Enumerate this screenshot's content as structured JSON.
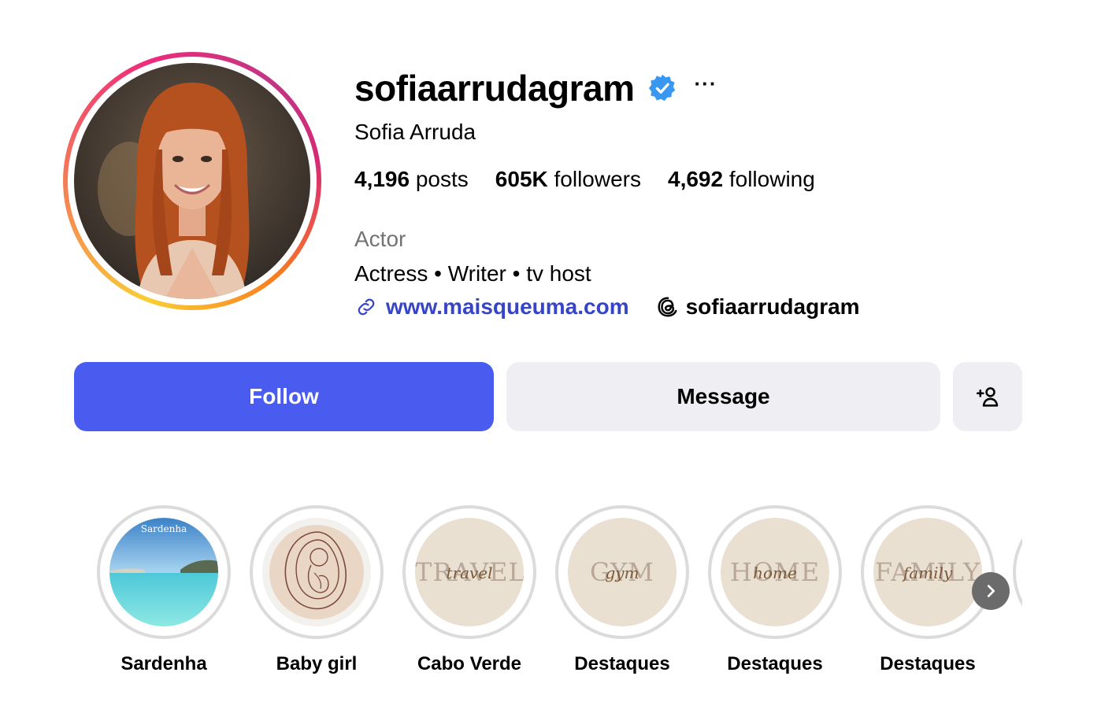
{
  "profile": {
    "username": "sofiaarrudagram",
    "verified_icon": "verified-badge-icon",
    "more_label": "···",
    "full_name": "Sofia Arruda",
    "stats": {
      "posts_count": "4,196",
      "posts_label": "posts",
      "followers_count": "605K",
      "followers_label": "followers",
      "following_count": "4,692",
      "following_label": "following"
    },
    "category": "Actor",
    "bio": "Actress • Writer • tv host",
    "website": "www.maisqueuma.com",
    "threads_handle": "sofiaarrudagram"
  },
  "actions": {
    "follow_label": "Follow",
    "message_label": "Message",
    "add_user_icon": "add-person-icon"
  },
  "highlights": [
    {
      "label": "Sardenha",
      "cover_text": "Sardenha"
    },
    {
      "label": "Baby girl"
    },
    {
      "label": "Cabo Verde",
      "cover_text": "TRAVEL",
      "cover_script": "travel"
    },
    {
      "label": "Destaques",
      "cover_text": "GYM",
      "cover_script": "gym"
    },
    {
      "label": "Destaques",
      "cover_text": "HOME",
      "cover_script": "home"
    },
    {
      "label": "Destaques",
      "cover_text": "FAMILY",
      "cover_script": "family"
    }
  ],
  "colors": {
    "follow_button": "#4a5cf0",
    "link": "#3644c8",
    "secondary_button": "#efeff3",
    "verified": "#3897f0"
  }
}
